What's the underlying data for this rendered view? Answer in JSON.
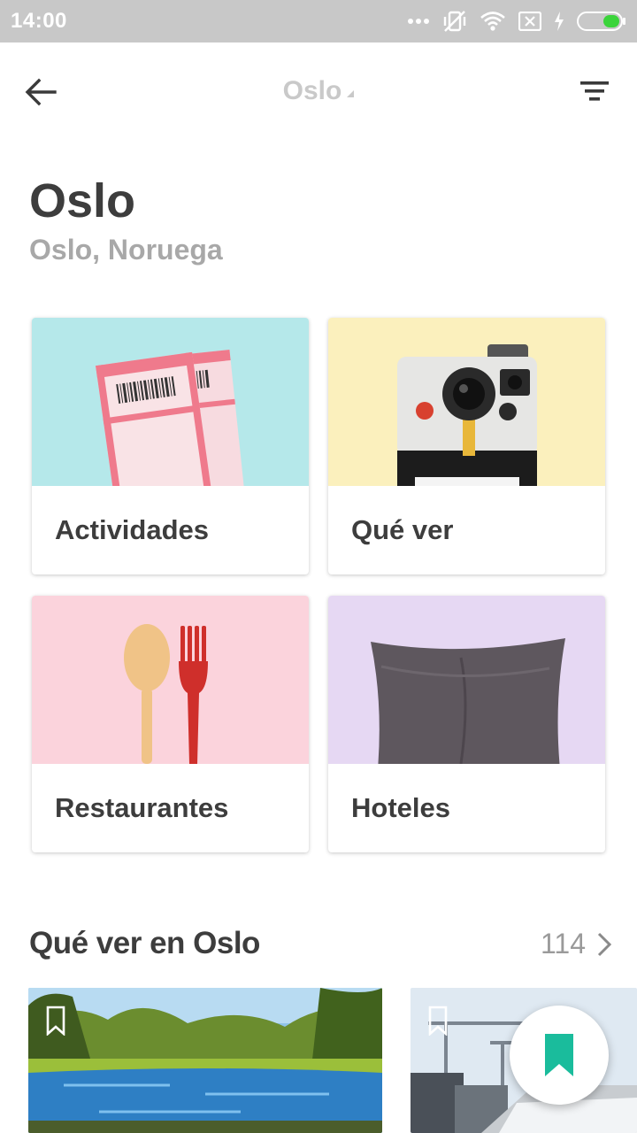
{
  "status_bar": {
    "time": "14:00",
    "icons": [
      "more-icon",
      "vibrate-off-icon",
      "wifi-icon",
      "sim-off-icon",
      "charging-icon",
      "battery-icon"
    ]
  },
  "app_bar": {
    "back_icon": "arrow-left-icon",
    "title": "Oslo",
    "filter_icon": "filter-icon"
  },
  "header": {
    "title": "Oslo",
    "subtitle": "Oslo, Noruega"
  },
  "categories": [
    {
      "label": "Actividades",
      "icon": "tickets-image",
      "bg": "#b5e8ea"
    },
    {
      "label": "Qué ver",
      "icon": "camera-image",
      "bg": "#fbf0bd"
    },
    {
      "label": "Restaurantes",
      "icon": "cutlery-image",
      "bg": "#fbd3dc"
    },
    {
      "label": "Hoteles",
      "icon": "pillow-image",
      "bg": "#e6d8f3"
    }
  ],
  "section": {
    "title": "Qué ver en Oslo",
    "count": "114"
  },
  "places": [
    {
      "image": "park-lake-photo"
    },
    {
      "image": "opera-house-photo"
    }
  ],
  "fab": {
    "icon": "bookmark-icon",
    "color": "#1abc9c"
  }
}
